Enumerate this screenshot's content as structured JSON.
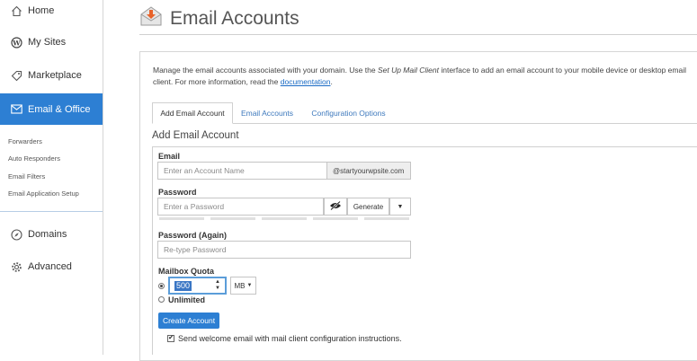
{
  "sidebar": {
    "items": [
      {
        "label": "Home",
        "icon": "home-icon"
      },
      {
        "label": "My Sites",
        "icon": "wordpress-icon"
      },
      {
        "label": "Marketplace",
        "icon": "tag-icon"
      },
      {
        "label": "Email & Office",
        "icon": "envelope-icon"
      },
      {
        "label": "Domains",
        "icon": "compass-icon"
      },
      {
        "label": "Advanced",
        "icon": "gear-icon"
      }
    ],
    "subitems": [
      "Forwarders",
      "Auto Responders",
      "Email Filters",
      "Email Application Setup"
    ],
    "active_color": "#2d7fd3"
  },
  "header": {
    "title": "Email Accounts",
    "icon": "email-download-icon"
  },
  "intro": {
    "before_italic": "Manage the email accounts associated with your domain. Use the ",
    "italic": "Set Up Mail Client",
    "after_italic": " interface to add an email account to your mobile device or desktop email client. For more information, read the ",
    "link": "documentation",
    "end": "."
  },
  "tabs": [
    "Add Email Account",
    "Email Accounts",
    "Configuration Options"
  ],
  "form": {
    "section_title": "Add Email Account",
    "email_label": "Email",
    "email_placeholder": "Enter an Account Name",
    "domain_suffix": "@startyourwpsite.com",
    "password_label": "Password",
    "password_placeholder": "Enter a Password",
    "generate_label": "Generate",
    "password_again_label": "Password (Again)",
    "password_again_placeholder": "Re-type Password",
    "quota_label": "Mailbox Quota",
    "quota_value": "500",
    "quota_unit": "MB",
    "unlimited_label": "Unlimited",
    "create_button": "Create Account",
    "welcome_label": "Send welcome email with mail client configuration instructions.",
    "welcome_checked": true
  },
  "colors": {
    "accent": "#2d7fd3",
    "tab_link": "#3e79bd",
    "header_icon": "#e8632a"
  }
}
